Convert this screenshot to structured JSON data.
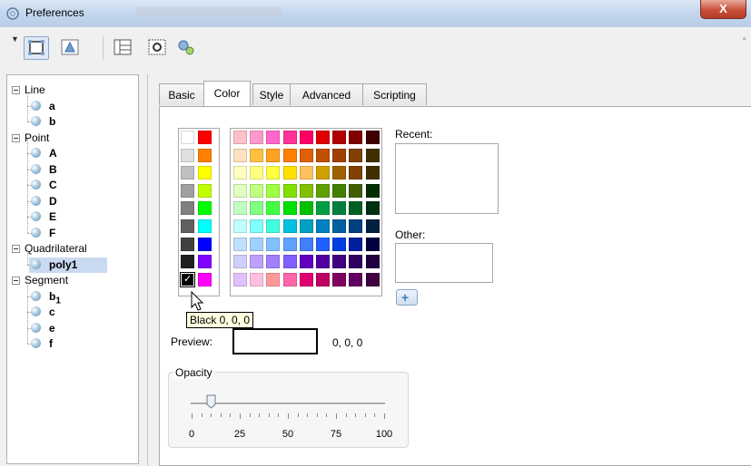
{
  "window": {
    "title": "Preferences",
    "close_label": "X"
  },
  "toolbar": {
    "collapse_glyph": "▼",
    "edge_glyph": "▫",
    "buttons": [
      "graphics-icon",
      "graphics2-icon",
      "layout-icon",
      "defaults-icon",
      "advanced-icon"
    ]
  },
  "tree": [
    {
      "category": "Line",
      "items": [
        {
          "label": "a"
        },
        {
          "label": "b"
        }
      ]
    },
    {
      "category": "Point",
      "items": [
        {
          "label": "A"
        },
        {
          "label": "B"
        },
        {
          "label": "C"
        },
        {
          "label": "D"
        },
        {
          "label": "E"
        },
        {
          "label": "F"
        }
      ]
    },
    {
      "category": "Quadrilateral",
      "items": [
        {
          "label": "poly1",
          "selected": true
        }
      ]
    },
    {
      "category": "Segment",
      "items": [
        {
          "label": "b",
          "sub": "1"
        },
        {
          "label": "c"
        },
        {
          "label": "e"
        },
        {
          "label": "f"
        }
      ]
    }
  ],
  "tabs": [
    "Basic",
    "Color",
    "Style",
    "Advanced",
    "Scripting"
  ],
  "active_tab": "Color",
  "colors": {
    "left_columns": [
      [
        "#ffffff",
        "#e0e0e0",
        "#c0c0c0",
        "#a0a0a0",
        "#808080",
        "#606060",
        "#404040",
        "#202020",
        "#000000"
      ],
      [
        "#ff0000",
        "#ff8000",
        "#ffff00",
        "#c0ff00",
        "#00ff00",
        "#00ffff",
        "#0000ff",
        "#8000ff",
        "#ff00ff"
      ]
    ],
    "main_grid": [
      [
        "#ffc0cb",
        "#ff99cc",
        "#ff66cc",
        "#ff3399",
        "#ff0066",
        "#e00000",
        "#b00000",
        "#800000",
        "#400000"
      ],
      [
        "#ffe0c0",
        "#ffc040",
        "#ffa020",
        "#ff8000",
        "#e06000",
        "#c05000",
        "#a04000",
        "#804000",
        "#403000"
      ],
      [
        "#ffffc0",
        "#ffff80",
        "#ffff40",
        "#ffe000",
        "#ffc060",
        "#d0a000",
        "#a06000",
        "#804000",
        "#403000"
      ],
      [
        "#e0ffc0",
        "#c0ff80",
        "#a0ff40",
        "#80e000",
        "#80c000",
        "#60a000",
        "#408000",
        "#406000",
        "#003000"
      ],
      [
        "#c0ffc0",
        "#80ff80",
        "#40ff40",
        "#00e000",
        "#00c000",
        "#00a040",
        "#008040",
        "#006020",
        "#003010"
      ],
      [
        "#c0ffff",
        "#80ffff",
        "#40ffe0",
        "#00c0e0",
        "#00a0c0",
        "#0080c0",
        "#0060a0",
        "#004080",
        "#002040"
      ],
      [
        "#c0e0ff",
        "#a0d0ff",
        "#80c0ff",
        "#60a0ff",
        "#4080ff",
        "#2060ff",
        "#0040e0",
        "#0020a0",
        "#000040"
      ],
      [
        "#d0d0ff",
        "#c0a0ff",
        "#a080ff",
        "#8060ff",
        "#6000c0",
        "#5000a0",
        "#400080",
        "#300060",
        "#200040"
      ],
      [
        "#e0c0ff",
        "#ffc0e0",
        "#ff9999",
        "#ff66aa",
        "#e00070",
        "#c00060",
        "#800060",
        "#600060",
        "#400040"
      ]
    ],
    "recent": [
      "#000000",
      "#cc0000",
      "#ff8800",
      "#ff3366",
      "#222222"
    ],
    "selected_color": "#000000"
  },
  "labels": {
    "recent": "Recent:",
    "other": "Other:",
    "tooltip": "Black 0, 0, 0",
    "preview": "Preview:",
    "preview_value": "0, 0, 0",
    "opacity": "Opacity",
    "add_symbol": "+"
  },
  "opacity": {
    "value": 10,
    "min": 0,
    "max": 100,
    "tick_labels": [
      "0",
      "25",
      "50",
      "75",
      "100"
    ]
  }
}
